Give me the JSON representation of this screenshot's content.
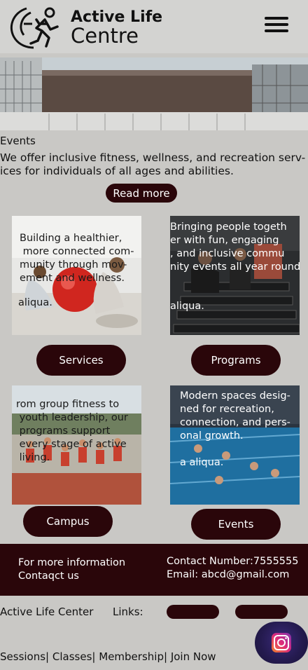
{
  "header": {
    "brand_line1": "Active Life",
    "brand_line2": "Centre",
    "menu_icon": "hamburger-menu-icon"
  },
  "hero": {
    "image": "building-exterior-photo"
  },
  "events": {
    "title": "Events",
    "intro": "We offer inclusive fitness, wellness, and recreation serv-\nices for individuals of all ages and abilities.",
    "read_more": "Read more"
  },
  "cards": [
    {
      "text": "Building a healthier,\n more connected com-\nmunity through mov-\nement and wellness.",
      "sub": "aliqua.",
      "button": "Services",
      "image": "fitness-ball-class-photo"
    },
    {
      "text": "Bringing people togeth\ner with fun, engaging\n, and inclusive commu\nnity events all year round.",
      "sub": "aliqua.",
      "button": "Programs",
      "image": "gym-dumbbells-photo"
    },
    {
      "text": "rom group fitness to\n youth leadership, our\n programs support\n every stage of active\n living.",
      "sub": "",
      "button": "Campus",
      "image": "running-race-photo"
    },
    {
      "text": "Modern spaces desig-\nned for recreation,\nconnection, and pers-\nonal growth.",
      "sub": "a aliqua.",
      "button": "Events",
      "image": "swimming-pool-photo"
    }
  ],
  "footer": {
    "more_info": "For more information\nContaqct us",
    "contact": "Contact Number:7555555\nEmail: abcd@gmail.com"
  },
  "bottom": {
    "name": "Active Life Center",
    "links_label": "Links:",
    "nav": [
      "Sessions",
      "Classes",
      "Membership",
      "Join Now"
    ],
    "separator": "|",
    "social_icon": "instagram-icon"
  }
}
